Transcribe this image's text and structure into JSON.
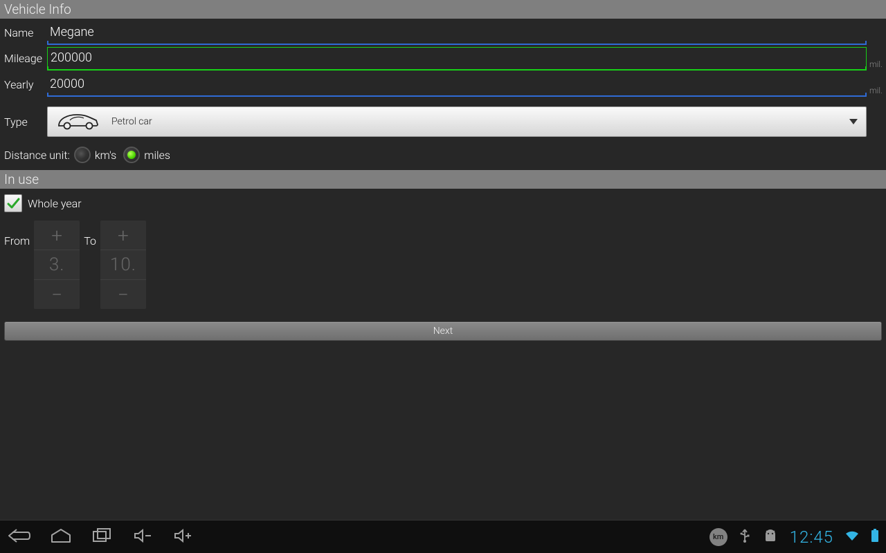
{
  "section1_title": "Vehicle Info",
  "name": {
    "label": "Name",
    "value": "Megane"
  },
  "mileage": {
    "label": "Mileage",
    "value": "200000",
    "unit": "mil."
  },
  "yearly": {
    "label": "Yearly",
    "value": "20000",
    "unit": "mil."
  },
  "type": {
    "label": "Type",
    "value": "Petrol car"
  },
  "distance_unit": {
    "label": "Distance unit:",
    "option_km": "km's",
    "option_miles": "miles",
    "selected": "miles"
  },
  "section2_title": "In use",
  "whole_year": {
    "label": "Whole year",
    "checked": true
  },
  "from": {
    "label": "From",
    "value": "3."
  },
  "to": {
    "label": "To",
    "value": "10."
  },
  "next_label": "Next",
  "sysbar": {
    "km_badge": "km",
    "clock": "12:45"
  }
}
